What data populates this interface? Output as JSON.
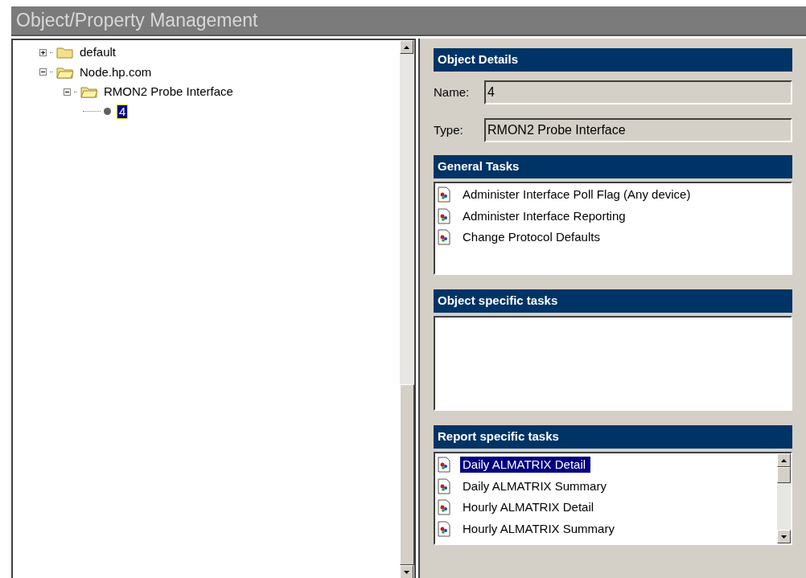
{
  "title": "Object/Property Management",
  "tree": [
    {
      "label": "default",
      "kind": "folder",
      "expanded": false,
      "selected": false
    },
    {
      "label": "Node.hp.com",
      "kind": "folder",
      "expanded": true,
      "selected": false,
      "children": [
        {
          "label": "RMON2 Probe Interface",
          "kind": "folder",
          "expanded": true,
          "selected": false,
          "children": [
            {
              "label": "4",
              "kind": "leaf",
              "selected": true
            }
          ]
        }
      ]
    }
  ],
  "object_details": {
    "header": "Object Details",
    "fields": [
      {
        "label": "Name:",
        "value": "4"
      },
      {
        "label": "Type:",
        "value": "RMON2 Probe Interface"
      }
    ]
  },
  "general_tasks": {
    "header": "General Tasks",
    "items": [
      {
        "label": "Administer Interface Poll Flag (Any device)",
        "selected": false
      },
      {
        "label": "Administer Interface Reporting",
        "selected": false
      },
      {
        "label": "Change Protocol Defaults",
        "selected": false
      }
    ]
  },
  "object_specific_tasks": {
    "header": "Object specific tasks"
  },
  "report_specific_tasks": {
    "header": "Report specific tasks",
    "items": [
      {
        "label": "Daily ALMATRIX Detail",
        "selected": true
      },
      {
        "label": "Daily ALMATRIX Summary",
        "selected": false
      },
      {
        "label": "Hourly ALMATRIX Detail",
        "selected": false
      },
      {
        "label": "Hourly ALMATRIX Summary",
        "selected": false
      }
    ]
  }
}
